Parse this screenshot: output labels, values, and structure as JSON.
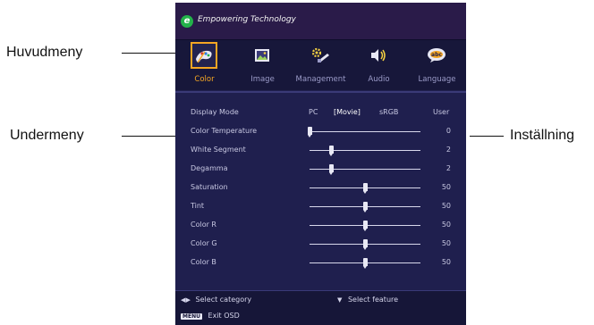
{
  "callouts": {
    "main_menu": "Huvudmeny",
    "sub_menu": "Undermeny",
    "setting": "Inställning"
  },
  "brand": {
    "logo_letter": "e",
    "text": "Empowering Technology"
  },
  "tabs": [
    {
      "label": "Color",
      "icon": "color-palette-icon",
      "active": true
    },
    {
      "label": "Image",
      "icon": "image-picture-icon",
      "active": false
    },
    {
      "label": "Management",
      "icon": "management-tools-icon",
      "active": false
    },
    {
      "label": "Audio",
      "icon": "speaker-icon",
      "active": false
    },
    {
      "label": "Language",
      "icon": "language-abc-icon",
      "active": false
    }
  ],
  "settings": {
    "display_mode": {
      "label": "Display Mode",
      "options": [
        "PC",
        "[Movie]",
        "sRGB",
        "User"
      ],
      "selected": "[Movie]"
    },
    "sliders": [
      {
        "label": "Color Temperature",
        "value": "0",
        "level": 0.0
      },
      {
        "label": "White Segment",
        "value": "2",
        "level": 0.2
      },
      {
        "label": "Degamma",
        "value": "2",
        "level": 0.2
      },
      {
        "label": "Saturation",
        "value": "50",
        "level": 0.5
      },
      {
        "label": "Tint",
        "value": "50",
        "level": 0.5
      },
      {
        "label": "Color R",
        "value": "50",
        "level": 0.5
      },
      {
        "label": "Color G",
        "value": "50",
        "level": 0.5
      },
      {
        "label": "Color B",
        "value": "50",
        "level": 0.5
      }
    ]
  },
  "footer": {
    "select_category": "Select category",
    "select_feature": "Select feature",
    "menu_key": "MENU",
    "exit_osd": "Exit OSD"
  },
  "colors": {
    "accent": "#f5a623",
    "panel": "#1f1f4e",
    "brand_green": "#23b24a"
  }
}
